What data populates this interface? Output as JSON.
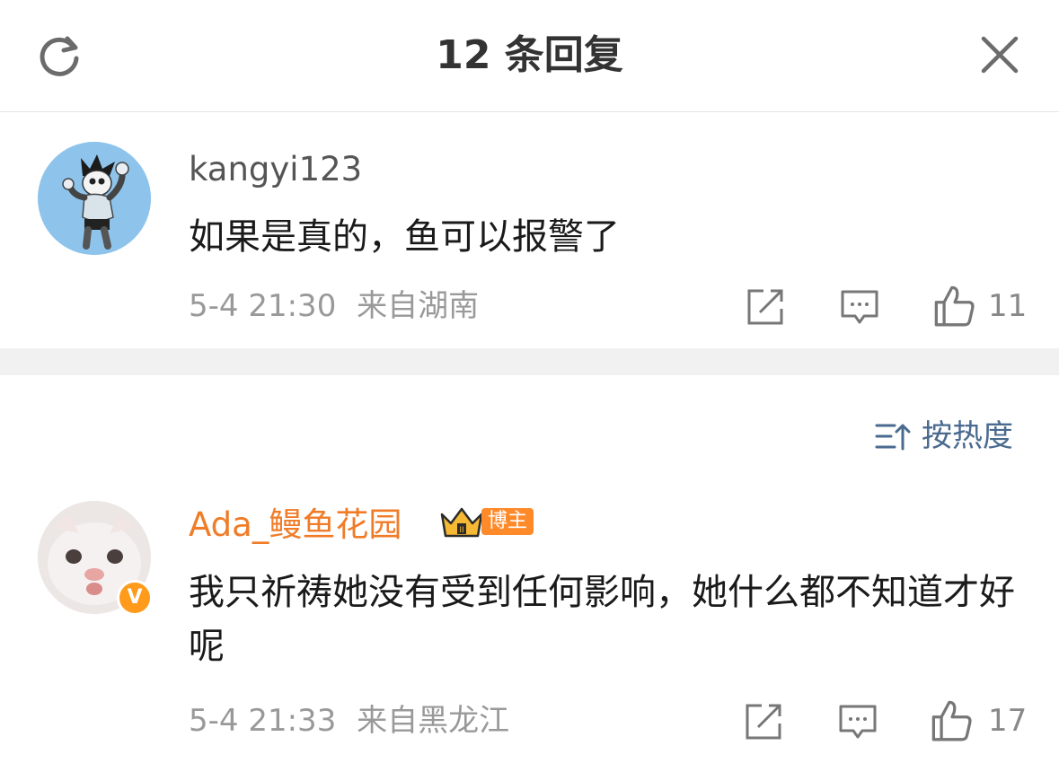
{
  "header": {
    "title": "12 条回复",
    "refresh_icon": "refresh-icon",
    "close_icon": "close-icon"
  },
  "colors": {
    "accent_orange": "#f07c28",
    "link_blue": "#4a6a8f",
    "meta_gray": "#999999",
    "divider": "#f1f1f1"
  },
  "root_comment": {
    "username": "kangyi123",
    "text": "如果是真的，鱼可以报警了",
    "timestamp": "5-4 21:30",
    "location": "来自湖南",
    "likes": "11",
    "avatar_icon": "astro-boy-avatar"
  },
  "sort": {
    "label": "按热度",
    "icon": "sort-icon"
  },
  "reply": {
    "username": "Ada_鳗鱼花园",
    "badge_label": "博主",
    "verified_mark": "V",
    "text": "我只祈祷她没有受到任何影响，她什么都不知道才好呢",
    "timestamp": "5-4 21:33",
    "location": "来自黑龙江",
    "likes": "17",
    "avatar_icon": "cat-avatar"
  }
}
